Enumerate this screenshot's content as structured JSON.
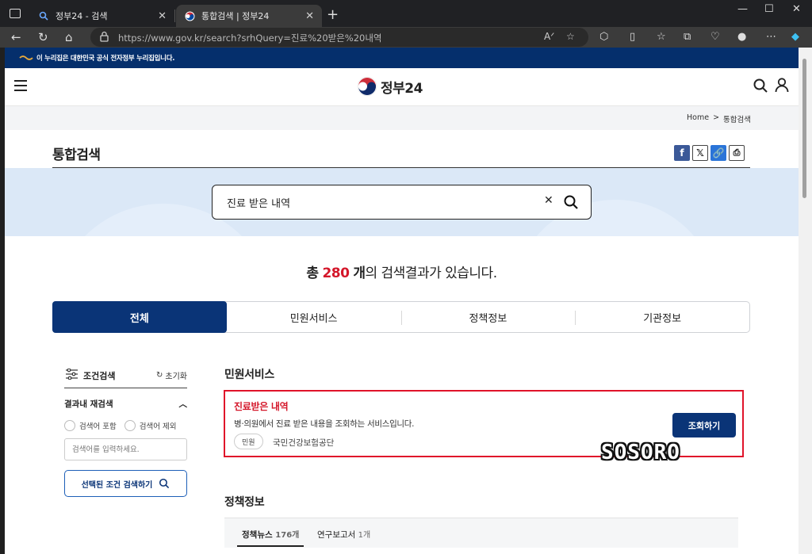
{
  "browser": {
    "tabs": [
      {
        "label": "정부24 - 검색"
      },
      {
        "label": "통합검색 | 정부24"
      }
    ],
    "url_host": "https://www.gov.kr",
    "url_path": "/search?srhQuery=진료%20받은%20내역"
  },
  "banner": {
    "text": "이 누리집은 대한민국 공식 전자정부 누리집입니다."
  },
  "header": {
    "logo_text": "정부24"
  },
  "breadcrumb": {
    "home": "Home",
    "separator": ">",
    "current": "통합검색"
  },
  "page": {
    "title": "통합검색"
  },
  "search": {
    "query": "진료 받은 내역"
  },
  "summary": {
    "prefix": "총",
    "count": "280",
    "unit": "개",
    "suffix": "의 검색결과가 있습니다."
  },
  "tabs": [
    {
      "label": "전체",
      "active": true
    },
    {
      "label": "민원서비스",
      "active": false
    },
    {
      "label": "정책정보",
      "active": false
    },
    {
      "label": "기관정보",
      "active": false
    }
  ],
  "filter": {
    "title": "조건검색",
    "reset_label": "초기화",
    "section_title": "결과내 재검색",
    "radio_include": "검색어 포함",
    "radio_exclude": "검색어 제외",
    "input_placeholder": "검색어를 입력하세요.",
    "button_label": "선택된 조건 검색하기"
  },
  "civil_service": {
    "section_title": "민원서비스",
    "result": {
      "title": "진료받은 내역",
      "description": "병·의원에서 진료 받은 내용을 조회하는 서비스입니다.",
      "tag": "민원",
      "org": "국민건강보험공단",
      "button_label": "조회하기"
    }
  },
  "watermark": "SOSORO",
  "policy": {
    "section_title": "정책정보",
    "subtabs": [
      {
        "label": "정책뉴스",
        "count": "176개"
      },
      {
        "label": "연구보고서",
        "count": "1개"
      }
    ]
  },
  "colors": {
    "brand_navy": "#0a3477",
    "highlight_red": "#d4172a",
    "banner_navy": "#052f6c"
  }
}
